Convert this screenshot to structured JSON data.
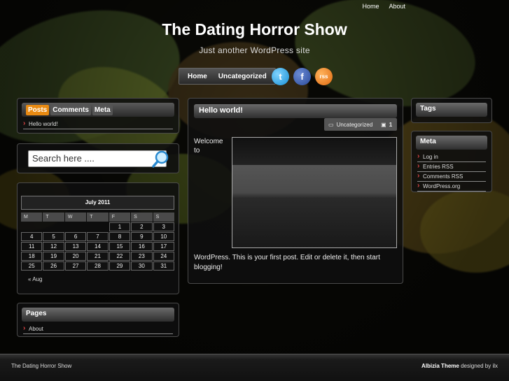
{
  "top_nav": {
    "home": "Home",
    "about": "About"
  },
  "site": {
    "title": "The Dating Horror Show",
    "tagline": "Just another WordPress site"
  },
  "main_nav": {
    "home": "Home",
    "uncategorized": "Uncategorized"
  },
  "social": {
    "twitter": "t",
    "facebook": "f",
    "rss": "rss"
  },
  "tabs": {
    "posts": "Posts",
    "comments": "Comments",
    "meta": "Meta",
    "items": [
      "Hello world!"
    ]
  },
  "search": {
    "placeholder": "Search here ...."
  },
  "calendar": {
    "caption": "July 2011",
    "days": [
      "M",
      "T",
      "W",
      "T",
      "F",
      "S",
      "S"
    ],
    "leading_blank": 4,
    "dates": [
      "1",
      "2",
      "3",
      "4",
      "5",
      "6",
      "7",
      "8",
      "9",
      "10",
      "11",
      "12",
      "13",
      "14",
      "15",
      "16",
      "17",
      "18",
      "19",
      "20",
      "21",
      "22",
      "23",
      "24",
      "25",
      "26",
      "27",
      "28",
      "29",
      "30",
      "31"
    ],
    "prev": "« Aug"
  },
  "pages": {
    "title": "Pages",
    "items": [
      "About"
    ]
  },
  "post": {
    "title": "Hello world!",
    "category": "Uncategorized",
    "comments": "1",
    "body_left": [
      "Welcome",
      "to"
    ],
    "text": "WordPress. This is your first post. Edit or delete it, then start blogging!"
  },
  "tags": {
    "title": "Tags"
  },
  "meta": {
    "title": "Meta",
    "items": [
      "Log in",
      "Entries RSS",
      "Comments RSS",
      "WordPress.org"
    ]
  },
  "footer": {
    "left": "The Dating Horror Show",
    "theme": "Albizia Theme",
    "designed": "designed by ilx"
  }
}
